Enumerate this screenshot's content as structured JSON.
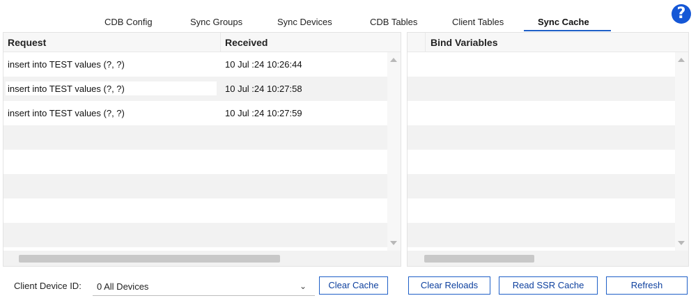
{
  "tabs": [
    {
      "label": "CDB Config"
    },
    {
      "label": "Sync Groups"
    },
    {
      "label": "Sync Devices"
    },
    {
      "label": "CDB Tables"
    },
    {
      "label": "Client Tables"
    },
    {
      "label": "Sync Cache"
    }
  ],
  "active_tab": "Sync Cache",
  "help": {
    "icon": "help-icon",
    "glyph": "?"
  },
  "requests_grid": {
    "columns": [
      "Request",
      "Received"
    ],
    "rows": [
      {
        "request": "insert into TEST values (?, ?)",
        "received": "10 Jul :24  10:26:44"
      },
      {
        "request": "insert into TEST values (?, ?)",
        "received": "10 Jul :24  10:27:58"
      },
      {
        "request": "insert into TEST values (?, ?)",
        "received": "10 Jul :24  10:27:59"
      }
    ]
  },
  "bind_grid": {
    "columns": [
      "Bind Variables"
    ],
    "rows": []
  },
  "client_device": {
    "label": "Client Device ID:",
    "selected": "0 All Devices"
  },
  "buttons": {
    "clear_cache": "Clear Cache",
    "clear_reloads": "Clear Reloads",
    "read_ssr_cache": "Read SSR Cache",
    "refresh": "Refresh"
  },
  "colors": {
    "accent": "#1e5fc7",
    "help": "#1557d6",
    "alt_row": "#f2f2f2"
  }
}
